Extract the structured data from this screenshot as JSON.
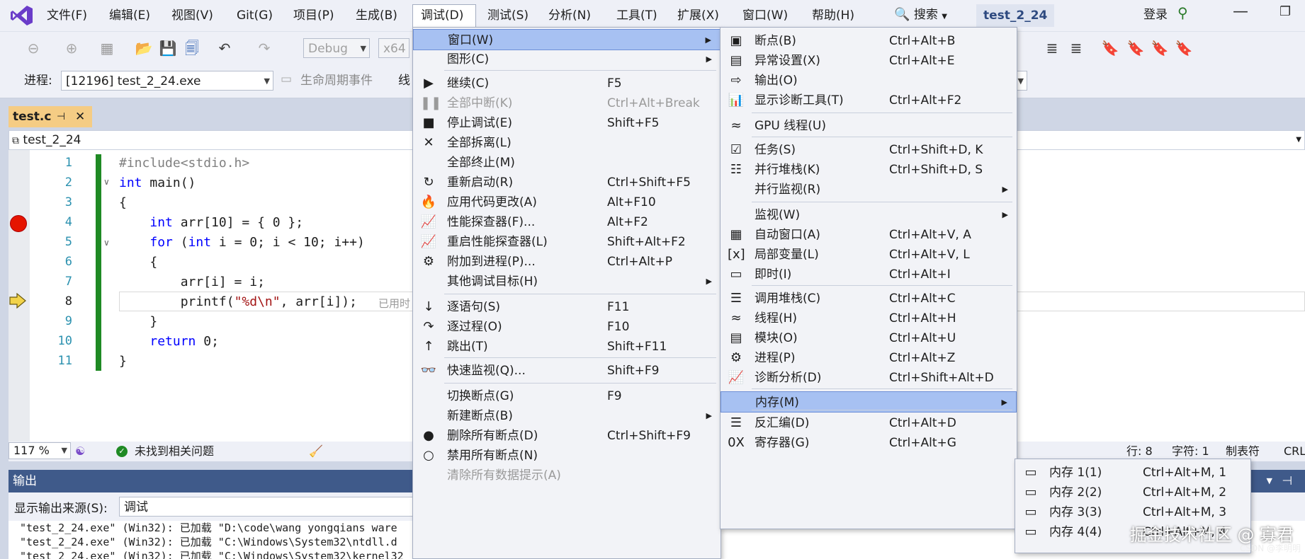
{
  "menubar": {
    "items": [
      "文件(F)",
      "编辑(E)",
      "视图(V)",
      "Git(G)",
      "项目(P)",
      "生成(B)",
      "调试(D)",
      "测试(S)",
      "分析(N)",
      "工具(T)",
      "扩展(X)",
      "窗口(W)",
      "帮助(H)"
    ],
    "search": "搜索",
    "solution": "test_2_24",
    "login": "登录"
  },
  "toolbar": {
    "config": "Debug",
    "platform": "x64",
    "process_label": "进程:",
    "process": "[12196] test_2_24.exe",
    "lifecycle": "生命周期事件",
    "thread_label": "线"
  },
  "editor": {
    "tab": "test.c",
    "nav_scope": "test_2_24",
    "lines": [
      "1",
      "2",
      "3",
      "4",
      "5",
      "6",
      "7",
      "8",
      "9",
      "10",
      "11"
    ],
    "inline_hint": "已用时",
    "zoom": "117 %",
    "issues": "未找到相关问题",
    "position": "行: 8",
    "column": "字符: 1",
    "tabs_mode": "制表符",
    "eol": "CRL"
  },
  "output": {
    "title": "输出",
    "source_label": "显示输出来源(S):",
    "source": "调试",
    "lines": [
      "\"test_2_24.exe\" (Win32): 已加载 \"D:\\code\\wang yongqians ware",
      "\"test_2_24.exe\" (Win32): 已加载 \"C:\\Windows\\System32\\ntdll.d",
      "\"test_2_24.exe\" (Win32): 已加载 \"C:\\Windows\\System32\\kernel32"
    ]
  },
  "debug_menu": [
    {
      "label": "窗口(W)",
      "shortcut": "",
      "sub": true,
      "icon": "",
      "state": "highlighted"
    },
    {
      "label": "图形(C)",
      "shortcut": "",
      "sub": true,
      "icon": ""
    },
    {
      "label": "继续(C)",
      "shortcut": "F5",
      "icon": "▶"
    },
    {
      "label": "全部中断(K)",
      "shortcut": "Ctrl+Alt+Break",
      "icon": "❚❚",
      "state": "disabled"
    },
    {
      "label": "停止调试(E)",
      "shortcut": "Shift+F5",
      "icon": "■"
    },
    {
      "label": "全部拆离(L)",
      "shortcut": "",
      "icon": "✕"
    },
    {
      "label": "全部终止(M)",
      "shortcut": "",
      "icon": ""
    },
    {
      "label": "重新启动(R)",
      "shortcut": "Ctrl+Shift+F5",
      "icon": "↻"
    },
    {
      "label": "应用代码更改(A)",
      "shortcut": "Alt+F10",
      "icon": "🔥"
    },
    {
      "label": "性能探查器(F)...",
      "shortcut": "Alt+F2",
      "icon": "📈"
    },
    {
      "label": "重启性能探查器(L)",
      "shortcut": "Shift+Alt+F2",
      "icon": "📈"
    },
    {
      "label": "附加到进程(P)...",
      "shortcut": "Ctrl+Alt+P",
      "icon": "⚙"
    },
    {
      "label": "其他调试目标(H)",
      "shortcut": "",
      "sub": true,
      "icon": ""
    },
    {
      "label": "逐语句(S)",
      "shortcut": "F11",
      "icon": "↓"
    },
    {
      "label": "逐过程(O)",
      "shortcut": "F10",
      "icon": "↷"
    },
    {
      "label": "跳出(T)",
      "shortcut": "Shift+F11",
      "icon": "↑"
    },
    {
      "label": "快速监视(Q)...",
      "shortcut": "Shift+F9",
      "icon": "👓"
    },
    {
      "label": "切换断点(G)",
      "shortcut": "F9",
      "icon": ""
    },
    {
      "label": "新建断点(B)",
      "shortcut": "",
      "sub": true,
      "icon": ""
    },
    {
      "label": "删除所有断点(D)",
      "shortcut": "Ctrl+Shift+F9",
      "icon": "●"
    },
    {
      "label": "禁用所有断点(N)",
      "shortcut": "",
      "icon": "○"
    },
    {
      "label": "清除所有数据提示(A)",
      "shortcut": "",
      "icon": "",
      "state": "disabled"
    }
  ],
  "window_menu": [
    {
      "label": "断点(B)",
      "shortcut": "Ctrl+Alt+B",
      "icon": "▣"
    },
    {
      "label": "异常设置(X)",
      "shortcut": "Ctrl+Alt+E",
      "icon": "▤"
    },
    {
      "label": "输出(O)",
      "shortcut": "",
      "icon": "⇨"
    },
    {
      "label": "显示诊断工具(T)",
      "shortcut": "Ctrl+Alt+F2",
      "icon": "📊"
    },
    {
      "label": "GPU 线程(U)",
      "shortcut": "",
      "icon": "≈"
    },
    {
      "label": "任务(S)",
      "shortcut": "Ctrl+Shift+D, K",
      "icon": "☑"
    },
    {
      "label": "并行堆栈(K)",
      "shortcut": "Ctrl+Shift+D, S",
      "icon": "☷"
    },
    {
      "label": "并行监视(R)",
      "shortcut": "",
      "sub": true,
      "icon": ""
    },
    {
      "label": "监视(W)",
      "shortcut": "",
      "sub": true,
      "icon": ""
    },
    {
      "label": "自动窗口(A)",
      "shortcut": "Ctrl+Alt+V, A",
      "icon": "▦"
    },
    {
      "label": "局部变量(L)",
      "shortcut": "Ctrl+Alt+V, L",
      "icon": "[x]"
    },
    {
      "label": "即时(I)",
      "shortcut": "Ctrl+Alt+I",
      "icon": "▭"
    },
    {
      "label": "调用堆栈(C)",
      "shortcut": "Ctrl+Alt+C",
      "icon": "☰"
    },
    {
      "label": "线程(H)",
      "shortcut": "Ctrl+Alt+H",
      "icon": "≈"
    },
    {
      "label": "模块(O)",
      "shortcut": "Ctrl+Alt+U",
      "icon": "▤"
    },
    {
      "label": "进程(P)",
      "shortcut": "Ctrl+Alt+Z",
      "icon": "⚙"
    },
    {
      "label": "诊断分析(D)",
      "shortcut": "Ctrl+Shift+Alt+D",
      "icon": "📈"
    },
    {
      "label": "内存(M)",
      "shortcut": "",
      "sub": true,
      "icon": "",
      "state": "highlighted"
    },
    {
      "label": "反汇编(D)",
      "shortcut": "Ctrl+Alt+D",
      "icon": "☰"
    },
    {
      "label": "寄存器(G)",
      "shortcut": "Ctrl+Alt+G",
      "icon": "0X"
    }
  ],
  "memory_menu": [
    {
      "label": "内存 1(1)",
      "shortcut": "Ctrl+Alt+M, 1"
    },
    {
      "label": "内存 2(2)",
      "shortcut": "Ctrl+Alt+M, 2"
    },
    {
      "label": "内存 3(3)",
      "shortcut": "Ctrl+Alt+M, 3"
    },
    {
      "label": "内存 4(4)",
      "shortcut": "Ctrl+Alt+M, 4"
    }
  ],
  "watermark": "掘金技术社区 @ 寡君",
  "watermark_small": "CSDN @李明明"
}
